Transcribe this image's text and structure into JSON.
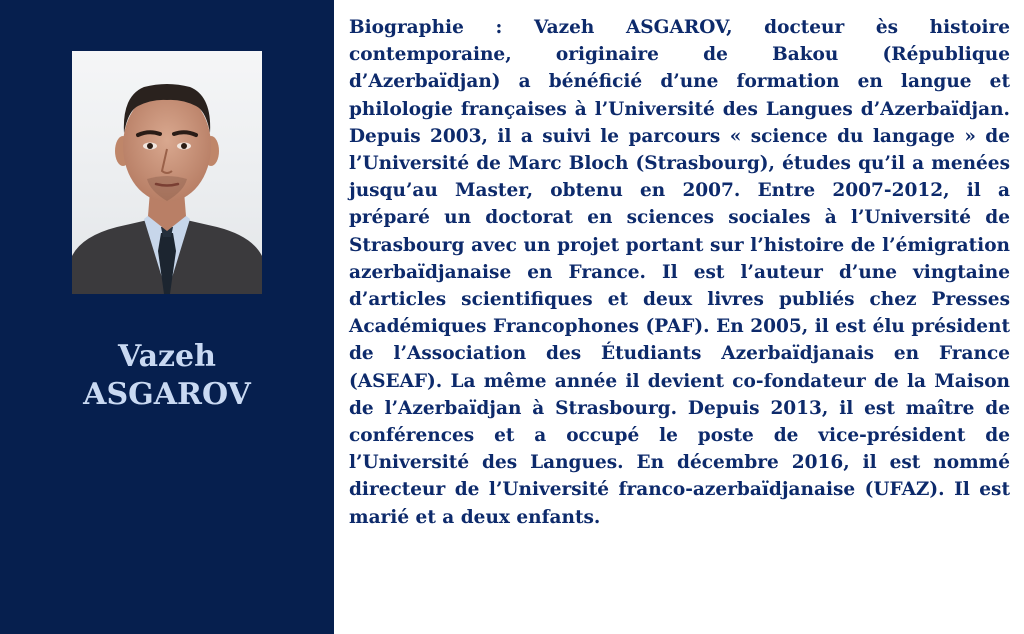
{
  "profile": {
    "first_name": "Vazeh",
    "last_name": "ASGAROV",
    "portrait_icon": "person-portrait-photo"
  },
  "bio": {
    "text": "Biographie : Vazeh ASGAROV, docteur ès histoire contemporaine, originaire de Bakou (République d’Azerbaïdjan) a bénéficié d’une formation en langue et philologie françaises à l’Université des Langues d’Azerbaïdjan. Depuis 2003, il a suivi le parcours « science du langage » de l’Université de Marc Bloch (Strasbourg), études qu’il a menées jusqu’au Master, obtenu en 2007. Entre 2007-2012, il a préparé un doctorat en sciences sociales à l’Université de Strasbourg avec un projet portant sur l’histoire de l’émigration azerbaïdjanaise en France. Il est l’auteur d’une vingtaine d’articles scientifiques et deux livres publiés chez Presses Académiques Francophones (PAF). En 2005, il est élu président de l’Association des Étudiants Azerbaïdjanais en France (ASEAF). La même année il devient co-fondateur de la Maison de l’Azerbaïdjan à Strasbourg. Depuis 2013, il est maître de conférences et a occupé le poste de vice-président de l’Université des Langues. En décembre 2016, il est nommé directeur de l’Université franco-azerbaïdjanaise (UFAZ). Il est marié et a deux enfants."
  },
  "colors": {
    "panel_background": "#061f4e",
    "name_text": "#c9d9f2",
    "bio_text": "#0d2a6b"
  }
}
